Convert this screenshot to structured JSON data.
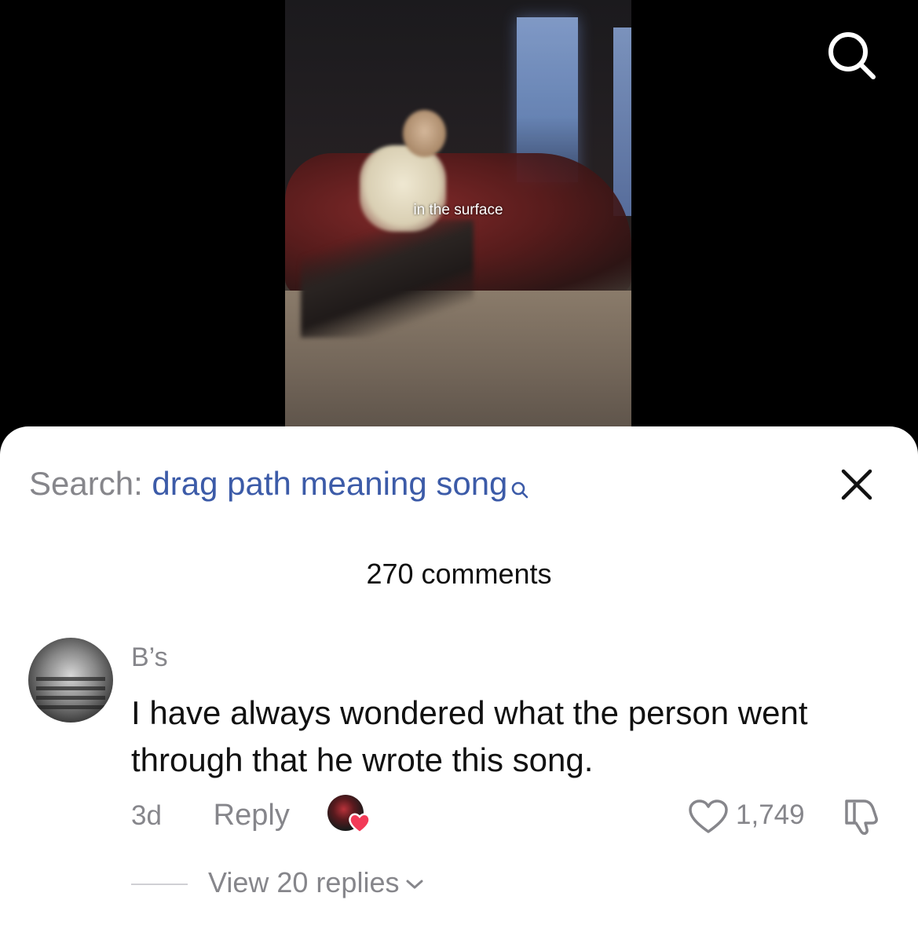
{
  "video": {
    "caption": "in the surface"
  },
  "top_bar": {
    "search_icon": "search-icon"
  },
  "sheet": {
    "search_prefix": "Search: ",
    "search_query": "drag path meaning song",
    "close_icon": "close-icon",
    "comment_count": "270 comments"
  },
  "comment": {
    "username": "B’s",
    "text": "I have always wondered what the person went through that he wrote this song.",
    "time": "3d",
    "reply_label": "Reply",
    "likes": "1,749",
    "view_replies": "View 20 replies"
  },
  "colors": {
    "query_link": "#3c5ba8",
    "muted_text": "#86868b",
    "heart_badge": "#f23a57"
  }
}
